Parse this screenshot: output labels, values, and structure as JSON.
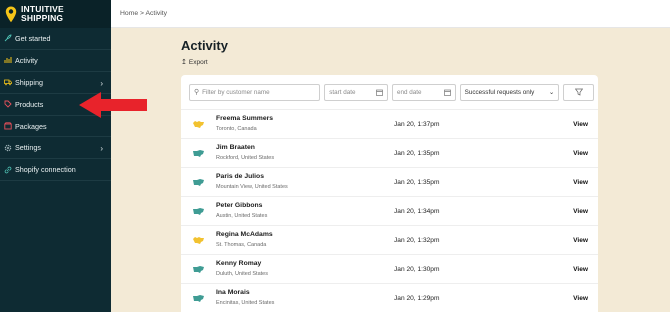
{
  "brand": {
    "line1": "INTUITIVE",
    "line2": "SHIPPING"
  },
  "sidebar": {
    "items": [
      {
        "label": "Get started",
        "icon": "rocket-icon",
        "chevron": false
      },
      {
        "label": "Activity",
        "icon": "chart-icon",
        "chevron": false
      },
      {
        "label": "Shipping",
        "icon": "truck-icon",
        "chevron": true
      },
      {
        "label": "Products",
        "icon": "tag-icon",
        "chevron": false
      },
      {
        "label": "Packages",
        "icon": "package-icon",
        "chevron": false
      },
      {
        "label": "Settings",
        "icon": "gear-icon",
        "chevron": true
      },
      {
        "label": "Shopify connection",
        "icon": "link-icon",
        "chevron": false
      }
    ]
  },
  "breadcrumb": "Home > Activity",
  "page": {
    "title": "Activity",
    "export_label": "Export"
  },
  "filters": {
    "search_placeholder": "Filter by customer name",
    "start_date_placeholder": "start date",
    "end_date_placeholder": "end date",
    "status_selected": "Successful requests only"
  },
  "rows": [
    {
      "name": "Freema Summers",
      "location": "Toronto, Canada",
      "time": "Jan 20, 1:37pm",
      "action": "View",
      "flag": "canada"
    },
    {
      "name": "Jim Braaten",
      "location": "Rockford, United States",
      "time": "Jan 20, 1:35pm",
      "action": "View",
      "flag": "usa"
    },
    {
      "name": "Paris de Julios",
      "location": "Mountain View, United States",
      "time": "Jan 20, 1:35pm",
      "action": "View",
      "flag": "usa"
    },
    {
      "name": "Peter Gibbons",
      "location": "Austin, United States",
      "time": "Jan 20, 1:34pm",
      "action": "View",
      "flag": "usa"
    },
    {
      "name": "Regina McAdams",
      "location": "St. Thomas, Canada",
      "time": "Jan 20, 1:32pm",
      "action": "View",
      "flag": "canada"
    },
    {
      "name": "Kenny Romay",
      "location": "Duluth, United States",
      "time": "Jan 20, 1:30pm",
      "action": "View",
      "flag": "usa"
    },
    {
      "name": "Ina Morais",
      "location": "Encinitas, United States",
      "time": "Jan 20, 1:29pm",
      "action": "View",
      "flag": "usa"
    }
  ],
  "colors": {
    "sidebar_bg": "#0e2b33",
    "page_bg": "#f3ead6",
    "canada_flag": "#f2c230",
    "usa_flag": "#3f9c94",
    "annotation_arrow": "#e8232b"
  }
}
